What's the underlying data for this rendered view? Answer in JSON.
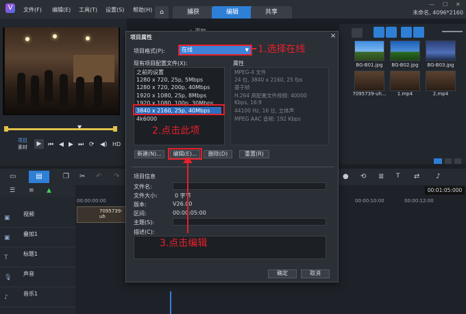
{
  "menubar": {
    "items": [
      "文件(F)",
      "编辑(E)",
      "工具(T)",
      "设置(S)",
      "帮助(H)"
    ],
    "tabs": [
      "捕获",
      "编辑",
      "共享"
    ],
    "active_tab": "编辑",
    "project_info": "未命名, 4096*2160"
  },
  "player": {
    "mode_labels": [
      "项目",
      "素材"
    ],
    "hd_label": "HD"
  },
  "library": {
    "add_label": "添加",
    "thumbs": [
      "BG-B01.jpg",
      "BG-B02.jpg",
      "BG-B03.jpg",
      "7095739-uh...",
      "1.mp4",
      "2.mp4"
    ]
  },
  "timeline": {
    "ruler": [
      "00:00:00:00",
      "00:00:10:00",
      "00:00:12:00"
    ],
    "timecode": "00:01:05:000",
    "clip_label": "7095739-uh",
    "tracks": [
      "视频",
      "叠加1",
      "标题1",
      "声音",
      "音乐1"
    ]
  },
  "dialog": {
    "title": "项目属性",
    "close": "×",
    "format_label": "项目格式(P):",
    "format_value": "在线",
    "profiles_label": "现有项目配置文件(X):",
    "props_label": "属性",
    "profiles": [
      "之前的设置",
      "1280 x 720, 25p, 5Mbps",
      "1280 x 720, 200p, 40Mbps",
      "1920 x 1080, 25p, 8Mbps",
      "1920 x 1080, 100p, 30Mbps",
      "3840 x 2160, 25p, 40Mbps",
      "4k6000"
    ],
    "selected_profile": "3840 x 2160, 25p, 40Mbps",
    "properties": [
      "MPEG-4 文件",
      "24 位, 3840 x 2160, 25 fps",
      "基于帧",
      "H.264 高配置文件视频: 40000",
      "Kbps, 16:9",
      "44100 Hz, 16 位, 立体声",
      "MPEG AAC 音频: 192 Kbps"
    ],
    "buttons": {
      "new": "新建(N)...",
      "edit": "编辑(E)...",
      "delete": "删除(D)",
      "reset": "重置(R)"
    },
    "info_title": "项目信息",
    "info": {
      "filename_label": "文件名:",
      "filesize_label": "文件大小:",
      "filesize_value": "0 字节",
      "version_label": "版本:",
      "version_value": "V26.00",
      "duration_label": "区间:",
      "duration_value": "00:00:05:00",
      "subject_label": "主题(S):",
      "desc_label": "描述(C):"
    },
    "ok": "确定",
    "cancel": "取消"
  },
  "annotations": {
    "step1": "1.选择在线",
    "step2": "2.点击此项",
    "step3": "3.点击编辑"
  }
}
